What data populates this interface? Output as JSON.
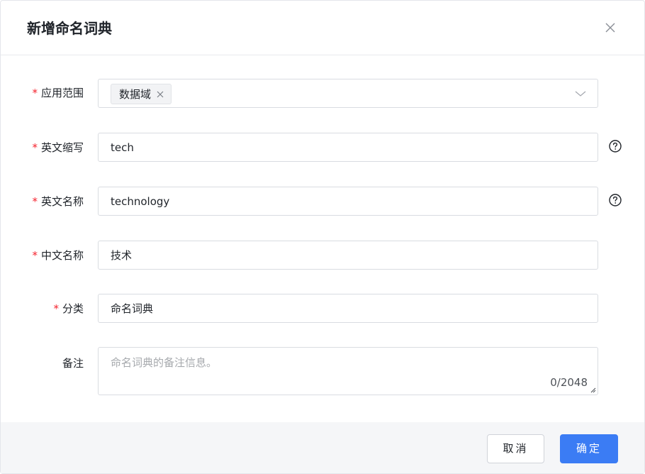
{
  "dialog": {
    "title": "新增命名词典"
  },
  "form": {
    "scope": {
      "label": "应用范围",
      "required": true,
      "tags": [
        "数据域"
      ]
    },
    "abbr": {
      "label": "英文缩写",
      "required": true,
      "value": "tech"
    },
    "en_name": {
      "label": "英文名称",
      "required": true,
      "value": "technology"
    },
    "cn_name": {
      "label": "中文名称",
      "required": true,
      "value": "技术"
    },
    "category": {
      "label": "分类",
      "required": true,
      "value": "命名词典"
    },
    "remark": {
      "label": "备注",
      "required": false,
      "placeholder": "命名词典的备注信息。",
      "counter": "0/2048"
    },
    "required_mark": "*"
  },
  "footer": {
    "cancel_label": "取消",
    "ok_label": "确定"
  },
  "colors": {
    "primary": "#3b7cf4",
    "required": "#f5222d",
    "footer_bg": "#f5f6f8"
  },
  "icons": {
    "close": "close-icon",
    "tag_close": "tag-close-icon",
    "dropdown": "chevron-down-icon",
    "help": "question-circle-icon",
    "resize": "resize-grip-icon"
  }
}
